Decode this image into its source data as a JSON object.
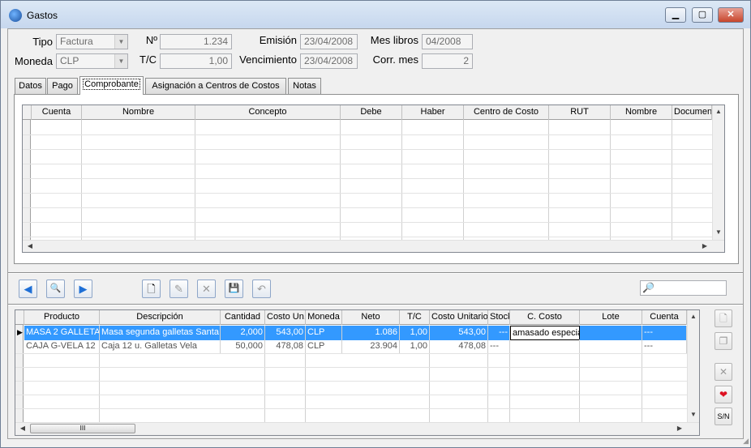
{
  "window": {
    "title": "Gastos",
    "minimize": "▁",
    "maximize": "▢",
    "close": "✕"
  },
  "header": {
    "tipo_label": "Tipo",
    "tipo_value": "Factura",
    "numero_label": "Nº",
    "numero_value": "1.234",
    "emision_label": "Emisión",
    "emision_value": "23/04/2008",
    "mes_libros_label": "Mes libros",
    "mes_libros_value": "04/2008",
    "moneda_label": "Moneda",
    "moneda_value": "CLP",
    "tc_label": "T/C",
    "tc_value": "1,00",
    "vencimiento_label": "Vencimiento",
    "vencimiento_value": "23/04/2008",
    "corr_mes_label": "Corr. mes",
    "corr_mes_value": "2"
  },
  "tabs": [
    "Datos",
    "Pago",
    "Comprobante",
    "Asignación a Centros de Costos",
    "Notas"
  ],
  "comprobante_columns": [
    "Cuenta",
    "Nombre",
    "Concepto",
    "Debe",
    "Haber",
    "Centro de Costo",
    "RUT",
    "Nombre",
    "Documen"
  ],
  "toolbar": {
    "prev_icon": "◀",
    "find_icon": "🔍",
    "next_icon": "▶",
    "new_icon": "🗋",
    "edit_icon": "✎",
    "delete_icon": "✕",
    "save_icon": "💾",
    "undo_icon": "↶",
    "search_icon": "🔎"
  },
  "product_columns": [
    "Producto",
    "Descripción",
    "Cantidad",
    "Costo Un.",
    "Moneda",
    "Neto",
    "T/C",
    "Costo Unitario",
    "Stock",
    "C. Costo",
    "Lote",
    "Cuenta"
  ],
  "product_rows": [
    [
      "MASA 2 GALLETA",
      "Masa segunda galletas Santa",
      "2,000",
      "543,00",
      "CLP",
      "1.086",
      "1,00",
      "543,00",
      "---",
      "amasado especia",
      "",
      "---"
    ],
    [
      "CAJA G-VELA 12",
      "Caja 12 u. Galletas Vela",
      "50,000",
      "478,08",
      "CLP",
      "23.904",
      "1,00",
      "478,08",
      "---",
      "",
      "",
      "---"
    ]
  ],
  "side_buttons": {
    "sn_label": "S/N"
  },
  "scroll": {
    "hscroll_grip": "III"
  }
}
